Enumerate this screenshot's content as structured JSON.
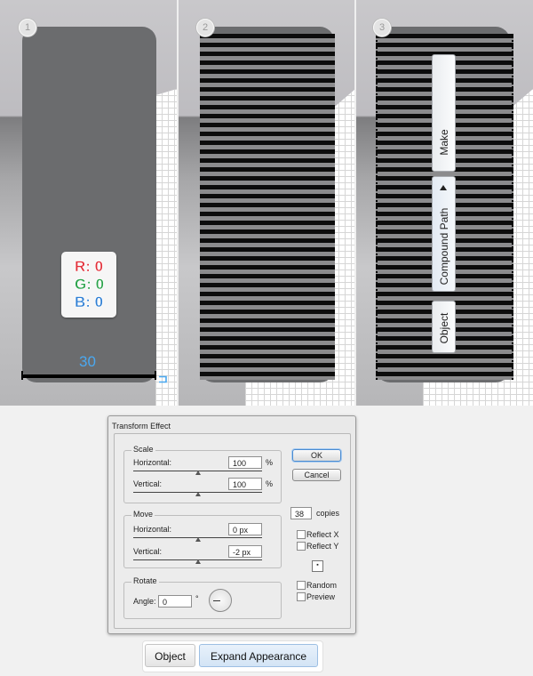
{
  "steps": [
    "1",
    "2",
    "3"
  ],
  "rgb": {
    "r": "R: 0",
    "g": "G: 0",
    "b": "B: 0"
  },
  "width_label": "30",
  "context_menu": {
    "make": "Make",
    "compound_path": "Compound Path",
    "object": "Object"
  },
  "dialog": {
    "title": "Transform Effect",
    "scale": {
      "legend": "Scale",
      "horizontal_label": "Horizontal:",
      "horizontal_value": "100",
      "vertical_label": "Vertical:",
      "vertical_value": "100",
      "unit": "%"
    },
    "move": {
      "legend": "Move",
      "horizontal_label": "Horizontal:",
      "horizontal_value": "0 px",
      "vertical_label": "Vertical:",
      "vertical_value": "-2 px"
    },
    "rotate": {
      "legend": "Rotate",
      "angle_label": "Angle:",
      "angle_value": "0",
      "degree": "°"
    },
    "ok": "OK",
    "cancel": "Cancel",
    "copies_value": "38",
    "copies_label": "copies",
    "reflect_x": "Reflect X",
    "reflect_y": "Reflect Y",
    "random": "Random",
    "preview": "Preview"
  },
  "bottom": {
    "object": "Object",
    "expand": "Expand Appearance"
  }
}
